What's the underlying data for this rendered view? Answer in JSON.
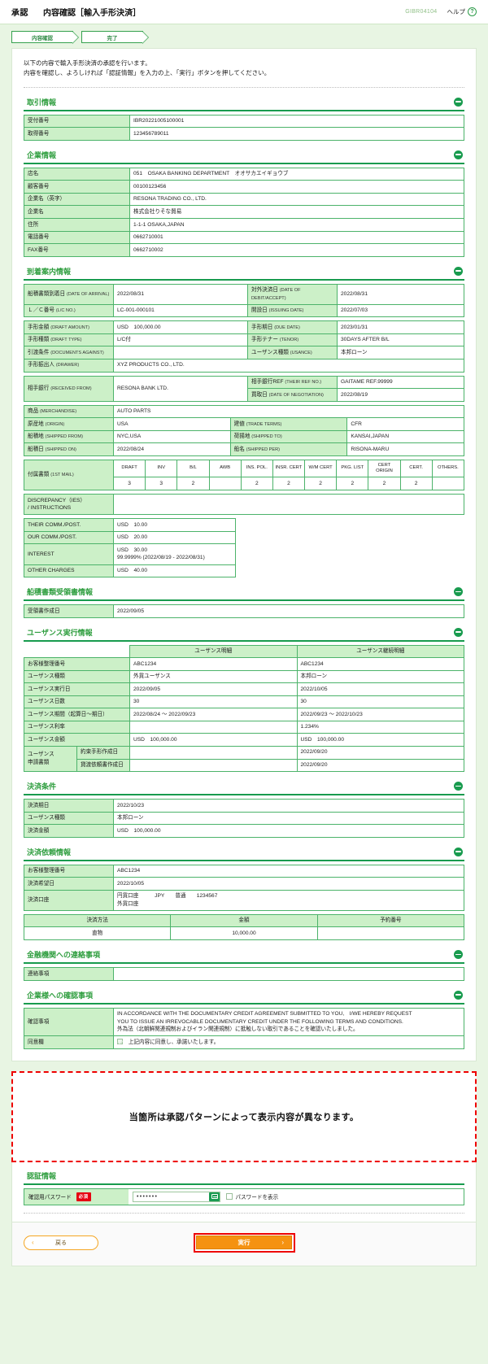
{
  "header": {
    "mode": "承認",
    "title": "内容確認［輸入手形決済］",
    "screen_code": "GIBR04104",
    "help_label": "ヘルプ",
    "help_icon": "?"
  },
  "steps": [
    {
      "label": "内容確認",
      "active": true
    },
    {
      "label": "完了",
      "active": false
    }
  ],
  "lead": {
    "line1": "以下の内容で輸入手形決済の承認を行います。",
    "line2": "内容を確認し、よろしければ「認証情報」を入力の上、「実行」ボタンを押してください。"
  },
  "sections": {
    "transaction": {
      "title": "取引情報",
      "rows": [
        {
          "label": "受付番号",
          "value": "IBR20221005100001"
        },
        {
          "label": "取得番号",
          "value": "123456789011"
        }
      ]
    },
    "company": {
      "title": "企業情報",
      "rows": [
        {
          "label": "店名",
          "value": "051　OSAKA BANKING DEPARTMENT　オオサカエイギョウブ"
        },
        {
          "label": "顧客番号",
          "value": "00100123456"
        },
        {
          "label": "企業名（英字）",
          "value": "RESONA TRADING CO., LTD."
        },
        {
          "label": "企業名",
          "value": "株式会社りそな貿易"
        },
        {
          "label": "住所",
          "value": "1-1-1 OSAKA,JAPAN"
        },
        {
          "label": "電話番号",
          "value": "0662710001"
        },
        {
          "label": "FAX番号",
          "value": "0662710002"
        }
      ]
    },
    "arrival": {
      "title": "到着案内情報",
      "block1": [
        {
          "label_jp": "船積書類到着日",
          "label_en": "(DATE OF ARRIVAL)",
          "value": "2022/08/31",
          "label2_jp": "対外決済日",
          "label2_en": "(DATE OF DEBIT/ACCEPT)",
          "value2": "2022/08/31"
        },
        {
          "label_jp": "Ｌ／Ｃ番号",
          "label_en": "(L/C NO.)",
          "value": "LC-001-000101",
          "label2_jp": "開設日",
          "label2_en": "(ISSUING DATE)",
          "value2": "2022/07/03"
        }
      ],
      "block2": [
        {
          "label_jp": "手形金額",
          "label_en": "(DRAFT AMOUNT)",
          "value": "USD　100,000.00",
          "label2_jp": "手形期日",
          "label2_en": "(DUE DATE)",
          "value2": "2023/01/31"
        },
        {
          "label_jp": "手形種類",
          "label_en": "(DRAFT TYPE)",
          "value": "L/C付",
          "label2_jp": "手形テナー",
          "label2_en": "(TENOR)",
          "value2": "30DAYS AFTER B/L"
        },
        {
          "label_jp": "引渡条件",
          "label_en": "(DOCUMENTS AGAINST)",
          "value": "",
          "label2_jp": "ユーザンス種類",
          "label2_en": "(USANCE)",
          "value2": "本邦ローン"
        }
      ],
      "drawer": {
        "label_jp": "手形振出人",
        "label_en": "(DRAWER)",
        "value": "XYZ PRODUCTS CO., LTD."
      },
      "block3": {
        "received_from": {
          "label_jp": "相手銀行",
          "label_en": "(RECEIVED FROM)",
          "value": "RESONA BANK LTD."
        },
        "their_ref": {
          "label_jp": "相手銀行REF",
          "label_en": "(THEIR REF NO.)",
          "value": "GAITAME REF.99999"
        },
        "negotiation": {
          "label_jp": "買取日",
          "label_en": "(DATE OF NEGOTIATION)",
          "value": "2022/08/19"
        }
      },
      "merchandise": {
        "label_jp": "商品",
        "label_en": "(MERCHANDISE)",
        "value": "AUTO PARTS"
      },
      "block4": [
        {
          "label_jp": "原産地",
          "label_en": "(ORIGIN)",
          "value": "USA",
          "label2_jp": "建値",
          "label2_en": "(TRADE TERMS)",
          "value2": "CFR"
        },
        {
          "label_jp": "船積地",
          "label_en": "(SHIPPED FROM)",
          "value": "NYC,USA",
          "label2_jp": "荷揚地",
          "label2_en": "(SHIPPED TO)",
          "value2": "KANSAI,JAPAN"
        },
        {
          "label_jp": "船積日",
          "label_en": "(SHIPPED ON)",
          "value": "2022/08/24",
          "label2_jp": "船名",
          "label2_en": "(SHIPPED PER)",
          "value2": "RISONA-MARU"
        }
      ],
      "docs": {
        "label_jp": "付属書類",
        "label_en": "(1ST MAIL)",
        "columns": [
          "DRAFT",
          "INV",
          "B/L",
          "AWB",
          "INS. POL.",
          "INSR. CERT",
          "W/M CERT",
          "PKG. LIST",
          "CERT ORIGIN",
          "CERT.",
          "OTHERS."
        ],
        "counts": [
          "3",
          "3",
          "2",
          "",
          "2",
          "2",
          "2",
          "2",
          "2",
          "2",
          ""
        ]
      },
      "discrepancy": {
        "label_line1": "DISCREPANCY（IES）",
        "label_line2": "/ INSTRUCTIONS",
        "value": ""
      },
      "charges": [
        {
          "label": "THEIR COMM./POST.",
          "value": "USD　10.00",
          "value2": ""
        },
        {
          "label": "OUR COMM./POST.",
          "value": "USD　20.00",
          "value2": ""
        },
        {
          "label": "INTEREST",
          "value": "USD　30.00",
          "value2": "99.9999% (2022/08/19 - 2022/08/31)"
        },
        {
          "label": "OTHER CHARGES",
          "value": "USD　40.00",
          "value2": ""
        }
      ]
    },
    "shipping_receipt": {
      "title": "船積書類受領書情報",
      "rows": [
        {
          "label": "受領書作成日",
          "value": "2022/09/05"
        }
      ]
    },
    "usance": {
      "title": "ユーザンス実行情報",
      "col_headers": [
        "",
        "ユーザンス明細",
        "ユーザンス継続明細"
      ],
      "rows": [
        {
          "label": "お客様整理番号",
          "v1": "ABC1234",
          "v2": "ABC1234"
        },
        {
          "label": "ユーザンス種類",
          "v1": "外貨ユーザンス",
          "v2": "本邦ローン"
        },
        {
          "label": "ユーザンス実行日",
          "v1": "2022/09/05",
          "v2": "2022/10/05"
        },
        {
          "label": "ユーザンス日数",
          "v1": "30",
          "v2": "30"
        },
        {
          "label": "ユーザンス期間（起算日～期日）",
          "v1": "2022/08/24 ～ 2022/09/23",
          "v2": "2022/09/23 ～ 2022/10/23"
        },
        {
          "label": "ユーザンス利率",
          "v1": "",
          "v2": "1.234%"
        },
        {
          "label": "ユーザンス金額",
          "v1": "USD　100,000.00",
          "v2": "USD　100,000.00"
        }
      ],
      "docs_group_label_line1": "ユーザンス",
      "docs_group_label_line2": "申請書類",
      "doc_rows": [
        {
          "label": "約束手形作成日",
          "v1": "",
          "v2": "2022/09/20"
        },
        {
          "label": "貸渡依頼書作成日",
          "v1": "",
          "v2": "2022/09/20"
        }
      ]
    },
    "settlement_terms": {
      "title": "決済条件",
      "rows": [
        {
          "label": "決済期日",
          "value": "2022/10/23"
        },
        {
          "label": "ユーザンス種類",
          "value": "本邦ローン"
        },
        {
          "label": "決済金額",
          "value": "USD　100,000.00"
        }
      ]
    },
    "settlement_request": {
      "title": "決済依頼情報",
      "rows": [
        {
          "label": "お客様整理番号",
          "value": "ABC1234"
        },
        {
          "label": "決済希望日",
          "value": "2022/10/05"
        }
      ],
      "account": {
        "label": "決済口座",
        "line1": "円貨口座　　　JPY　　普通　　1234567",
        "line2": "外貨口座"
      },
      "method_table": {
        "columns": [
          "決済方法",
          "金額",
          "予約番号"
        ],
        "rows": [
          {
            "method": "直物",
            "amount": "10,000.00",
            "reservation": ""
          }
        ]
      }
    },
    "bank_message": {
      "title": "金融機関への連絡事項",
      "rows": [
        {
          "label": "連絡事項",
          "value": ""
        }
      ]
    },
    "confirmation": {
      "title": "企業様への確認事項",
      "items_label": "確認事項",
      "items_text_line1": "IN ACCORDANCE WITH THE DOCUMENTARY CREDIT AGREEMENT SUBMITTED TO YOU,　I/WE HEREBY REQUEST",
      "items_text_line2": "YOU TO ISSUE AN IRREVOCABLE DOCUMENTARY CREDIT UNDER THE FOLLOWING TERMS AND CONDITIONS.",
      "items_text_line3": "外為法（北朝鮮関連規制およびイラン関連規制）に抵触しない取引であることを確認いたしました。",
      "consent_label": "同意欄",
      "consent_text": "上記内容に同意し、承諾いたします。",
      "consent_checked": true
    }
  },
  "annotation": {
    "text": "当箇所は承認パターンによって表示内容が異なります。"
  },
  "auth": {
    "title": "認証情報",
    "password_label": "確認用パスワード",
    "required_badge": "必須",
    "password_value": "•••••••",
    "keyboard_icon": "software-keyboard",
    "show_password_label": "パスワードを表示",
    "show_password_checked": false
  },
  "footer": {
    "back_label": "戻る",
    "back_chevron": "‹",
    "execute_label": "実行",
    "execute_chevron": "›"
  },
  "colors": {
    "brand_green": "#189b4e",
    "section_title": "#2f9e3f",
    "table_border": "#4cb36a",
    "label_bg": "#ccf0c8",
    "page_bg": "#e8f5e3",
    "required_red": "#e60012",
    "annotation_red": "#ee0000",
    "execute_orange": "#f59211",
    "back_orange": "#f5a623"
  }
}
